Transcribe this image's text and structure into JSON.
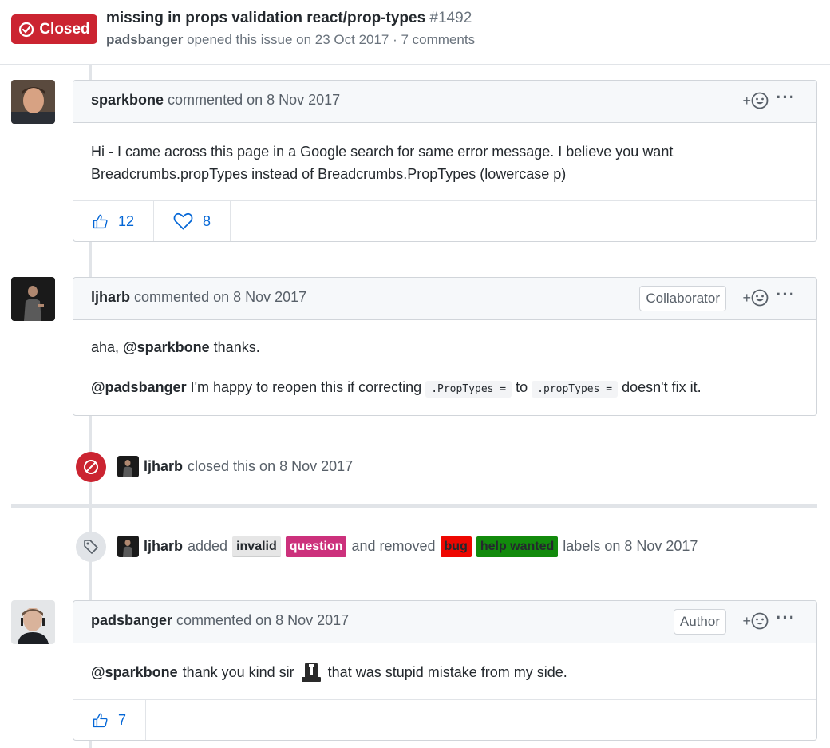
{
  "issue": {
    "state": "Closed",
    "title": "missing in props validation react/prop-types",
    "number": "#1492",
    "author": "padsbanger",
    "opened_text": "opened this issue on 23 Oct 2017 · 7 comments"
  },
  "comments": [
    {
      "author": "sparkbone",
      "meta": "commented on 8 Nov 2017",
      "body_line1": "Hi - I came across this page in a Google search for same error message. I believe you want",
      "body_line2": "Breadcrumbs.propTypes instead of Breadcrumbs.PropTypes (lowercase p)",
      "reactions": [
        {
          "icon": "thumbs-up-icon",
          "count": "12"
        },
        {
          "icon": "heart-icon",
          "count": "8"
        }
      ]
    },
    {
      "author": "ljharb",
      "meta": "commented on 8 Nov 2017",
      "role": "Collaborator",
      "p1_pre": "aha,",
      "p1_mention": "@sparkbone",
      "p1_post": "thanks.",
      "p2_mention": "@padsbanger",
      "p2_text1": "I'm happy to reopen this if correcting",
      "p2_code1": ".PropTypes =",
      "p2_text2": "to",
      "p2_code2": ".propTypes =",
      "p2_text3": "doesn't fix it."
    },
    {
      "author": "padsbanger",
      "meta": "commented on 8 Nov 2017",
      "role": "Author",
      "mention": "@sparkbone",
      "text1": "thank you kind sir",
      "text2": "that was stupid mistake from my side.",
      "reactions": [
        {
          "icon": "thumbs-up-icon",
          "count": "7"
        }
      ]
    }
  ],
  "events": {
    "closed": {
      "actor": "ljharb",
      "text": "closed this on 8 Nov 2017"
    },
    "labeled": {
      "actor": "ljharb",
      "added_text": "added",
      "added_labels": [
        {
          "name": "invalid",
          "bg": "#e6e6e6",
          "fg": "#24292e"
        },
        {
          "name": "question",
          "bg": "#cc317c",
          "fg": "#ffffff"
        }
      ],
      "removed_text": "and removed",
      "removed_labels": [
        {
          "name": "bug",
          "bg": "#ee0701",
          "fg": "#24292e"
        },
        {
          "name": "help wanted",
          "bg": "#128a0c",
          "fg": "#24292e"
        }
      ],
      "suffix": "labels on 8 Nov 2017"
    }
  },
  "ui": {
    "add_reaction": "+",
    "more": "···"
  },
  "colors": {
    "closed_red": "#cb2431",
    "link_blue": "#0366d6",
    "border": "#d1d5da"
  }
}
